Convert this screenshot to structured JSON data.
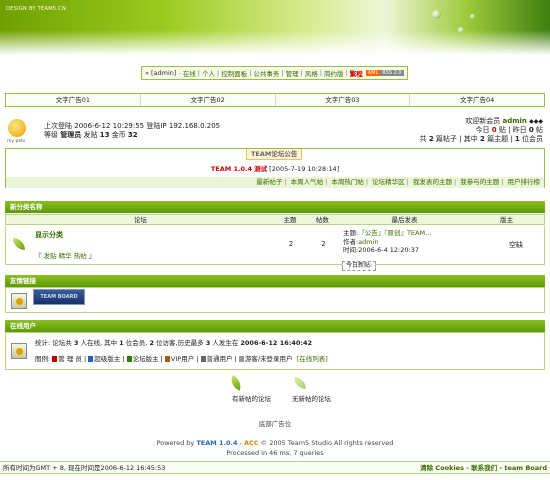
{
  "banner": {
    "tagline": "DESIGN BY TEAM5.CN"
  },
  "nav": {
    "prefix": "»",
    "items": [
      "[admin]",
      "在线",
      "个人",
      "控制面板",
      "公共事务",
      "管理",
      "风格",
      "简约版",
      "繁程"
    ],
    "xml": "XML",
    "rss": "RSS 2.0"
  },
  "ads": [
    "文字广告01",
    "文字广告02",
    "文字广告03",
    "文字广告04"
  ],
  "user": {
    "avatar_label": "my pets",
    "last_login_label": "上次登陆",
    "last_login_time": "2006-6-12 10:29:55",
    "ip_label": "登陆IP",
    "ip": "192.168.0.205",
    "level_label": "等级",
    "level": "管理员",
    "posts_label": "发贴",
    "posts": "13",
    "gold_label": "金币",
    "gold": "32",
    "welcome_label": "欢迎新会员",
    "new_member": "admin",
    "today_label": "今日",
    "today_count": "0",
    "today_unit": "贴",
    "yesterday_label": "昨日",
    "yesterday_count": "0",
    "yesterday_unit": "帖",
    "total_label": "共",
    "total_posts": "2",
    "total_posts_unit": "篇帖子",
    "main_label": "其中",
    "main_topics": "2",
    "main_topics_unit": "篇主题",
    "members_count": "1",
    "members_unit": "位会员"
  },
  "notice": {
    "title": "TEAM论坛公告",
    "version": "TEAM 1.0.4",
    "test": "测试",
    "date": "[2005-7-19 10:28:14]",
    "links": [
      "最新帖子",
      "本周人气帖",
      "本周热门帖",
      "论坛精华区",
      "我发表的主题",
      "我参与的主题",
      "用户排行榜"
    ]
  },
  "category": {
    "title": "新分类名称",
    "columns": [
      "论坛",
      "主题",
      "帖数",
      "最后发表",
      "版主"
    ]
  },
  "forum": {
    "name": "显示分类",
    "tags": [
      "『",
      "发贴",
      "精华",
      "热帖",
      "』"
    ],
    "topics": "2",
    "posts": "2",
    "last_topic_label": "主题:",
    "last_topic": "『公告』『原创』TEAM...",
    "author_label": "作者:",
    "author": "admin",
    "time_label": "时间:",
    "time": "2006-6-4 12:20:37",
    "new_today": "今日新贴:",
    "moderator": "空缺"
  },
  "friends": {
    "title": "友情链接",
    "logo_text": "TEAM BOARD"
  },
  "online": {
    "title": "在线用户",
    "stats_prefix": "统计: 论坛共",
    "total": "3",
    "mid1": "人在线, 其中",
    "members": "1",
    "mid2": "位会员,",
    "guests": "2",
    "mid3": "位访客,历史最多",
    "max": "3",
    "mid4": "人发生在",
    "max_time": "2006-6-12 16:40:42",
    "legend_label": "图例:",
    "legend": [
      "管 理 员",
      "超级版主",
      "论坛版主",
      "VIP用户",
      "普通用户",
      "游客/未登录用户"
    ],
    "list_link": "[在线列表]",
    "colors": [
      "#c00000",
      "#2060c0",
      "#2a8000",
      "#a06000",
      "#666666",
      "#999999"
    ]
  },
  "legend_bottom": {
    "new": "有新帖的论坛",
    "none": "无新帖的论坛"
  },
  "footer": {
    "ad": "底部广告位",
    "powered": "Powered by",
    "team": "TEAM 1.0.4",
    "dash": "-",
    "acc": "ACC",
    "copy": "© 2005 Team5 Studio All rights reserved",
    "processed": "Processed in 46 ms, 7 queries"
  },
  "status": {
    "left": "所有时间为GMT + 8, 现在时间是2006-6-12 16:45:53",
    "right": "清除 Cookies - 联系我们 - team Board"
  }
}
